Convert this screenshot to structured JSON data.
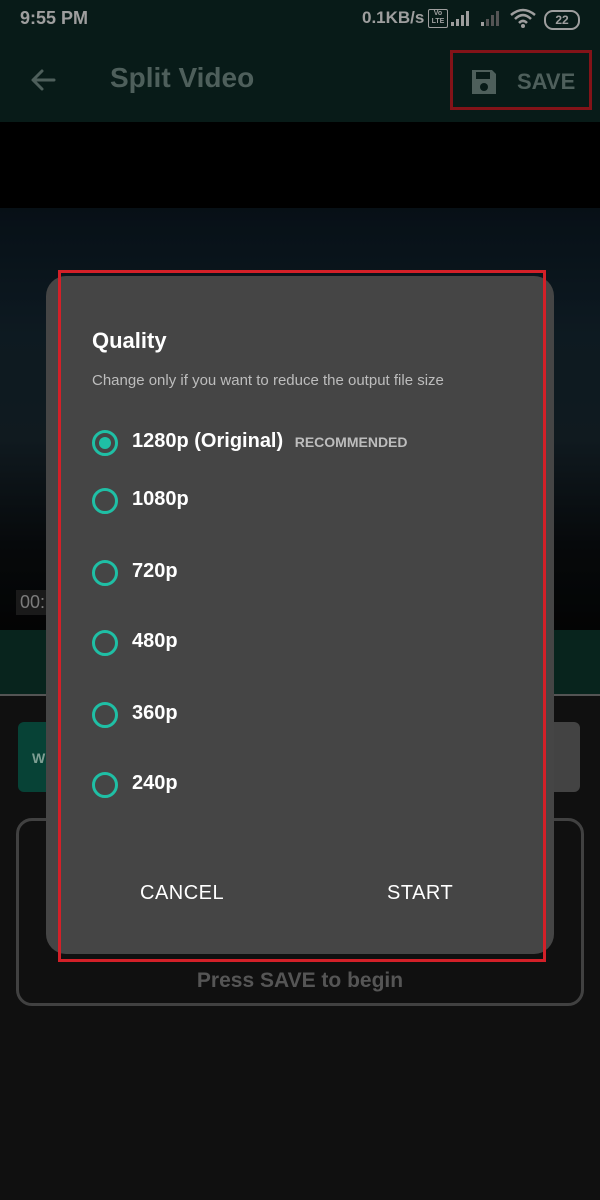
{
  "status_bar": {
    "time": "9:55 PM",
    "network_speed": "0.1KB/s",
    "volte": "Vo LTE",
    "battery": "22",
    "icons": [
      "volte-icon",
      "signal-icon",
      "signal-weak-icon",
      "wifi-icon",
      "battery-icon"
    ]
  },
  "toolbar": {
    "title": "Split Video",
    "save_label": "SAVE",
    "icons": [
      "back-arrow-icon",
      "floppy-disk-icon"
    ]
  },
  "player": {
    "time_readout": "00:"
  },
  "background": {
    "chip_label": "W",
    "hint": "Press SAVE to begin"
  },
  "dialog": {
    "title": "Quality",
    "subtitle": "Change only if you want to reduce the output file size",
    "options": [
      {
        "label": "1280p (Original)",
        "badge": "RECOMMENDED",
        "selected": true
      },
      {
        "label": "1080p",
        "badge": "",
        "selected": false
      },
      {
        "label": "720p",
        "badge": "",
        "selected": false
      },
      {
        "label": "480p",
        "badge": "",
        "selected": false
      },
      {
        "label": "360p",
        "badge": "",
        "selected": false
      },
      {
        "label": "240p",
        "badge": "",
        "selected": false
      }
    ],
    "cancel_label": "CANCEL",
    "start_label": "START"
  },
  "colors": {
    "accent": "#1fbfa5",
    "toolbar": "#0d2d27",
    "dialog_bg": "#454545",
    "highlight": "#d32028"
  }
}
